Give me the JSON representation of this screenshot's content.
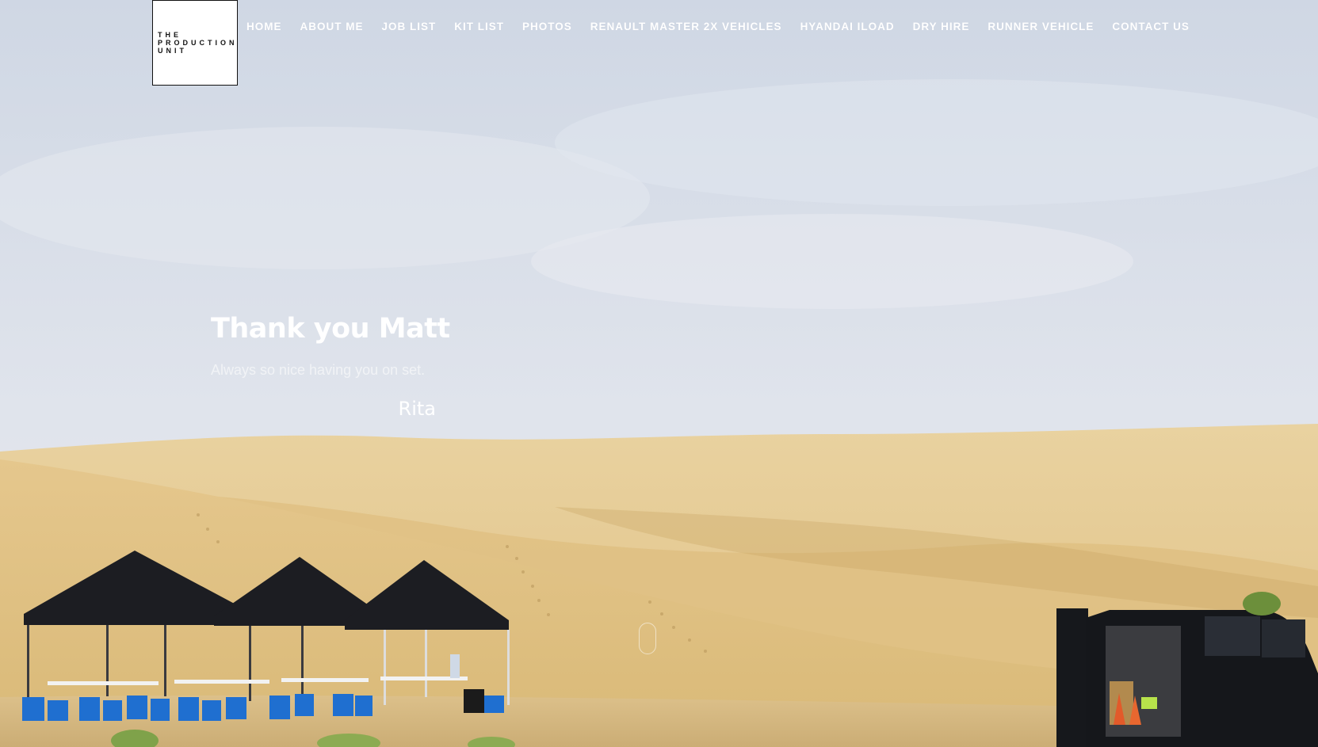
{
  "logo": {
    "lines": [
      "THE",
      "PRODUCTION",
      "UNIT"
    ]
  },
  "nav": {
    "items": [
      {
        "label": "HOME"
      },
      {
        "label": "ABOUT ME"
      },
      {
        "label": "JOB LIST"
      },
      {
        "label": "KIT LIST"
      },
      {
        "label": "PHOTOS"
      },
      {
        "label": "RENAULT MASTER 2X VEHICLES"
      },
      {
        "label": "HYANDAI ILOAD"
      },
      {
        "label": "DRY HIRE"
      },
      {
        "label": "RUNNER VEHICLE"
      },
      {
        "label": "CONTACT US"
      }
    ]
  },
  "testimonial": {
    "title": "Thank you Matt",
    "quote": "Always so nice having you on set.",
    "author": "Rita"
  },
  "colors": {
    "sky": "#d7dde8",
    "sand": "#e6c98a",
    "sand_dark": "#d2ad67",
    "tent": "#1e1e22",
    "stool": "#1f6fd0",
    "van": "#15171b",
    "nav_text": "#ffffff"
  },
  "icons": {
    "scroll": "mouse-scroll-icon"
  }
}
